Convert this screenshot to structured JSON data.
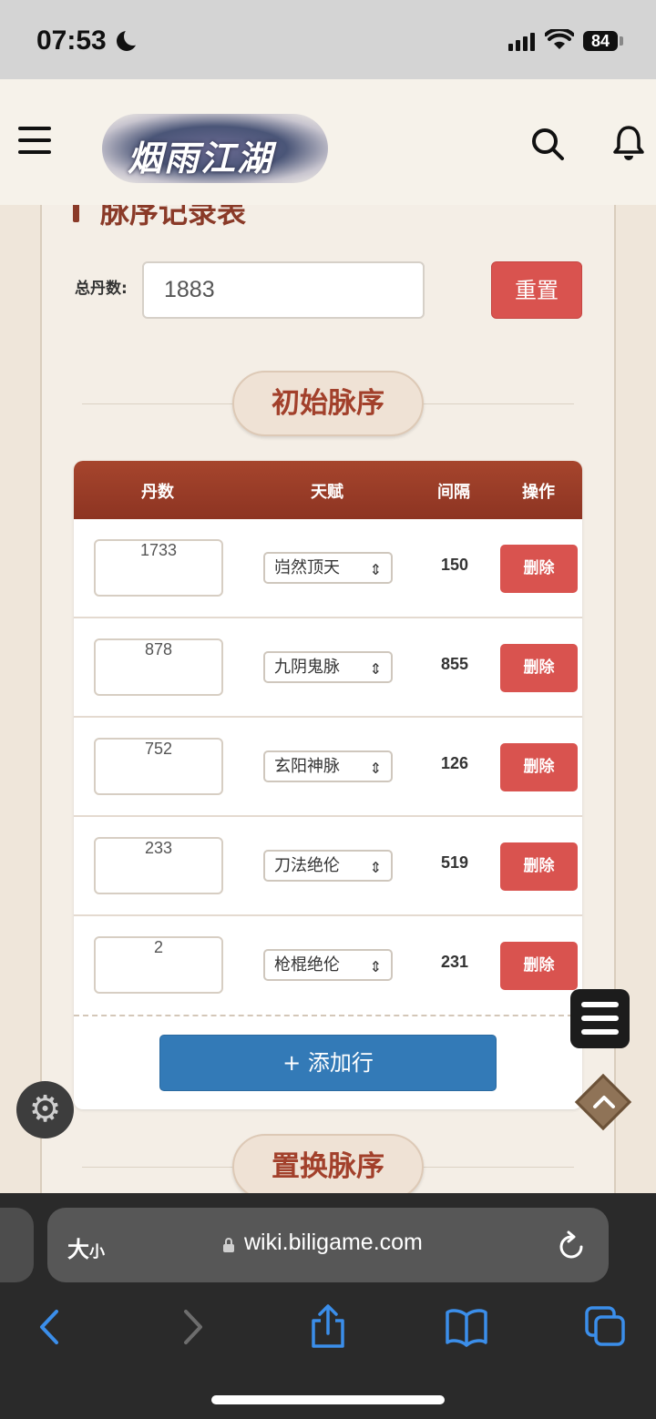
{
  "status_bar": {
    "time": "07:53",
    "battery": "84"
  },
  "header": {
    "logo_text": "烟雨江湖"
  },
  "section": {
    "heading": "脉序记录表"
  },
  "total": {
    "label": "总丹数:",
    "value": "1883",
    "reset_label": "重置"
  },
  "initial_pill": "初始脉序",
  "replace_pill": "置换脉序",
  "table": {
    "headers": [
      "丹数",
      "天赋",
      "间隔",
      "操作"
    ],
    "rows": [
      {
        "dan": "1733",
        "talent": "岿然顶天",
        "gap": "150",
        "action": "删除"
      },
      {
        "dan": "878",
        "talent": "九阴鬼脉",
        "gap": "855",
        "action": "删除"
      },
      {
        "dan": "752",
        "talent": "玄阳神脉",
        "gap": "126",
        "action": "删除"
      },
      {
        "dan": "233",
        "talent": "刀法绝伦",
        "gap": "519",
        "action": "删除"
      },
      {
        "dan": "2",
        "talent": "枪棍绝伦",
        "gap": "231",
        "action": "删除"
      }
    ],
    "add_row_label": "+ 添加行"
  },
  "browser": {
    "aa_big": "大",
    "aa_small": "小",
    "url": "wiki.biligame.com"
  },
  "colors": {
    "accent_red": "#d9534f",
    "header_brown": "#9a3c27",
    "add_blue": "#337ab7"
  }
}
